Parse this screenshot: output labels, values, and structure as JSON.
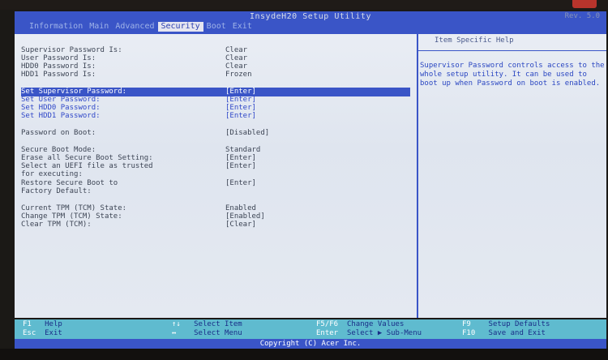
{
  "header": {
    "title": "InsydeH20 Setup Utility",
    "oem_mark": "Rev. 5.0",
    "tabs": [
      {
        "label": "Information",
        "active": false
      },
      {
        "label": "Main",
        "active": false
      },
      {
        "label": "Advanced",
        "active": false
      },
      {
        "label": "Security",
        "active": true
      },
      {
        "label": "Boot",
        "active": false
      },
      {
        "label": "Exit",
        "active": false
      }
    ]
  },
  "status": {
    "supervisor_label": "Supervisor Password Is:",
    "supervisor_value": "Clear",
    "user_label": "User Password Is:",
    "user_value": "Clear",
    "hdd0_label": "HDD0 Password Is:",
    "hdd0_value": "Clear",
    "hdd1_label": "HDD1 Password Is:",
    "hdd1_value": "Frozen"
  },
  "set_passwords": {
    "supervisor_label": "Set Supervisor Password:",
    "supervisor_value": "[Enter]",
    "user_label": "Set User Password:",
    "user_value": "[Enter]",
    "hdd0_label": "Set HDD0 Password:",
    "hdd0_value": "[Enter]",
    "hdd1_label": "Set HDD1 Password:",
    "hdd1_value": "[Enter]"
  },
  "password_on_boot": {
    "label": "Password on Boot:",
    "value": "[Disabled]"
  },
  "secure_boot": {
    "mode_label": "Secure Boot Mode:",
    "mode_value": "Standard",
    "erase_label": "Erase all Secure Boot Setting:",
    "erase_value": "[Enter]",
    "select_label_1": "Select an UEFI file as trusted",
    "select_label_2": "for executing:",
    "select_value": "[Enter]",
    "restore_label_1": "Restore Secure Boot to",
    "restore_label_2": "Factory Default:",
    "restore_value": "[Enter]"
  },
  "tpm": {
    "current_label": "Current TPM (TCM) State:",
    "current_value": "Enabled",
    "change_label": "Change TPM (TCM) State:",
    "change_value": "[Enabled]",
    "clear_label": "Clear TPM (TCM):",
    "clear_value": "[Clear]"
  },
  "help": {
    "title": "Item Specific Help",
    "text": "Supervisor Password controls access to the whole setup utility. It can be used to boot up when Password on boot is enabled."
  },
  "footer": {
    "f1_key": "F1",
    "f1_desc": "Help",
    "esc_key": "Esc",
    "esc_desc": "Exit",
    "updown_key": "↑↓",
    "updown_desc": "Select Item",
    "leftright_key": "↔",
    "leftright_desc": "Select Menu",
    "f5f6_key": "F5/F6",
    "f5f6_desc": "Change Values",
    "enter_key": "Enter",
    "enter_desc": "Select ▶ Sub-Menu",
    "f9_key": "F9",
    "f9_desc": "Setup Defaults",
    "f10_key": "F10",
    "f10_desc": "Save and Exit",
    "copyright": "Copyright (C) Acer Inc."
  },
  "colors": {
    "header_blue": "#3a55c7",
    "panel_bg": "#e4e9f1",
    "footer_cyan": "#5fbbcf",
    "link_blue": "#3048c8",
    "text_gray": "#3d4555"
  }
}
